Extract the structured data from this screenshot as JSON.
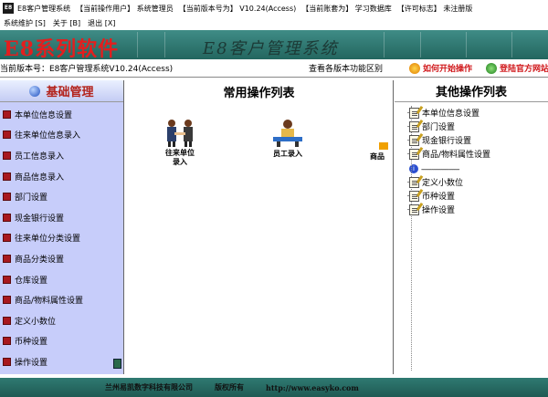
{
  "title_bar": {
    "app_name": "E8客户管理系统",
    "operator": "【当前操作用户】 系统管理员",
    "version": "【当前版本号为】 V10.24(Access)",
    "account": "【当前账套为】 学习数据库",
    "license": "【许可标志】 未注册版"
  },
  "menu": [
    {
      "label": "系统维护 [S]"
    },
    {
      "label": "关于 [B]"
    },
    {
      "label": "退出 [X]"
    }
  ],
  "banner": {
    "brand": "E8系列软件",
    "system_name": "E8客户管理系统"
  },
  "status": {
    "version_text": "当前版本号：E8客户管理系统V10.24(Access)",
    "diff_link": "查看各版本功能区别",
    "howto_link": "如何开始操作",
    "site_link": "登陆官方网站"
  },
  "left_panel": {
    "title": "基础管理",
    "items": [
      {
        "label": "本单位信息设置"
      },
      {
        "label": "往来单位信息录入"
      },
      {
        "label": "员工信息录入"
      },
      {
        "label": "商品信息录入"
      },
      {
        "label": "部门设置"
      },
      {
        "label": "现金银行设置"
      },
      {
        "label": "往来单位分类设置"
      },
      {
        "label": "商品分类设置"
      },
      {
        "label": "仓库设置"
      },
      {
        "label": "商品/物料属性设置"
      },
      {
        "label": "定义小数位"
      },
      {
        "label": "币种设置"
      },
      {
        "label": "操作设置"
      }
    ]
  },
  "center_panel": {
    "title": "常用操作列表",
    "ops": [
      {
        "label": "往来单位录入"
      },
      {
        "label": "员工录入"
      },
      {
        "label": "商品"
      }
    ]
  },
  "right_panel": {
    "title": "其他操作列表",
    "group1": [
      {
        "label": "本单位信息设置"
      },
      {
        "label": "部门设置"
      },
      {
        "label": "现金银行设置"
      },
      {
        "label": "商品/物料属性设置"
      }
    ],
    "separator": "----------------------",
    "group2": [
      {
        "label": "定义小数位"
      },
      {
        "label": "币种设置"
      },
      {
        "label": "操作设置"
      }
    ]
  },
  "footer": {
    "company": "兰州易凯数字科技有限公司",
    "rights": "版权所有",
    "url": "http://www.easyko.com"
  },
  "colors": {
    "banner": "#2f7a72",
    "brand_red": "#e31e1e",
    "left_bg": "#c7cdfa",
    "accent_red": "#b3231c"
  }
}
